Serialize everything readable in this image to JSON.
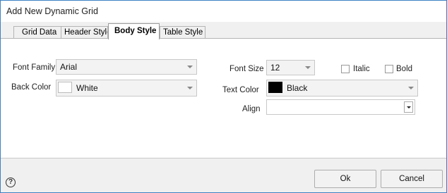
{
  "window": {
    "title": "Add New Dynamic Grid"
  },
  "tabs": [
    {
      "label": "Grid Data"
    },
    {
      "label": "Header Style"
    },
    {
      "label": "Body Style"
    },
    {
      "label": "Table Style"
    }
  ],
  "form": {
    "font_family": {
      "label": "Font Family",
      "value": "Arial"
    },
    "back_color": {
      "label": "Back Color",
      "value": "White",
      "swatch": "#ffffff"
    },
    "font_size": {
      "label": "Font Size",
      "value": "12"
    },
    "text_color": {
      "label": "Text Color",
      "value": "Black",
      "swatch": "#000000"
    },
    "align": {
      "label": "Align",
      "value": ""
    },
    "italic": {
      "label": "Italic",
      "checked": false
    },
    "bold": {
      "label": "Bold",
      "checked": false
    }
  },
  "footer": {
    "help_glyph": "?",
    "ok_label": "Ok",
    "cancel_label": "Cancel"
  }
}
